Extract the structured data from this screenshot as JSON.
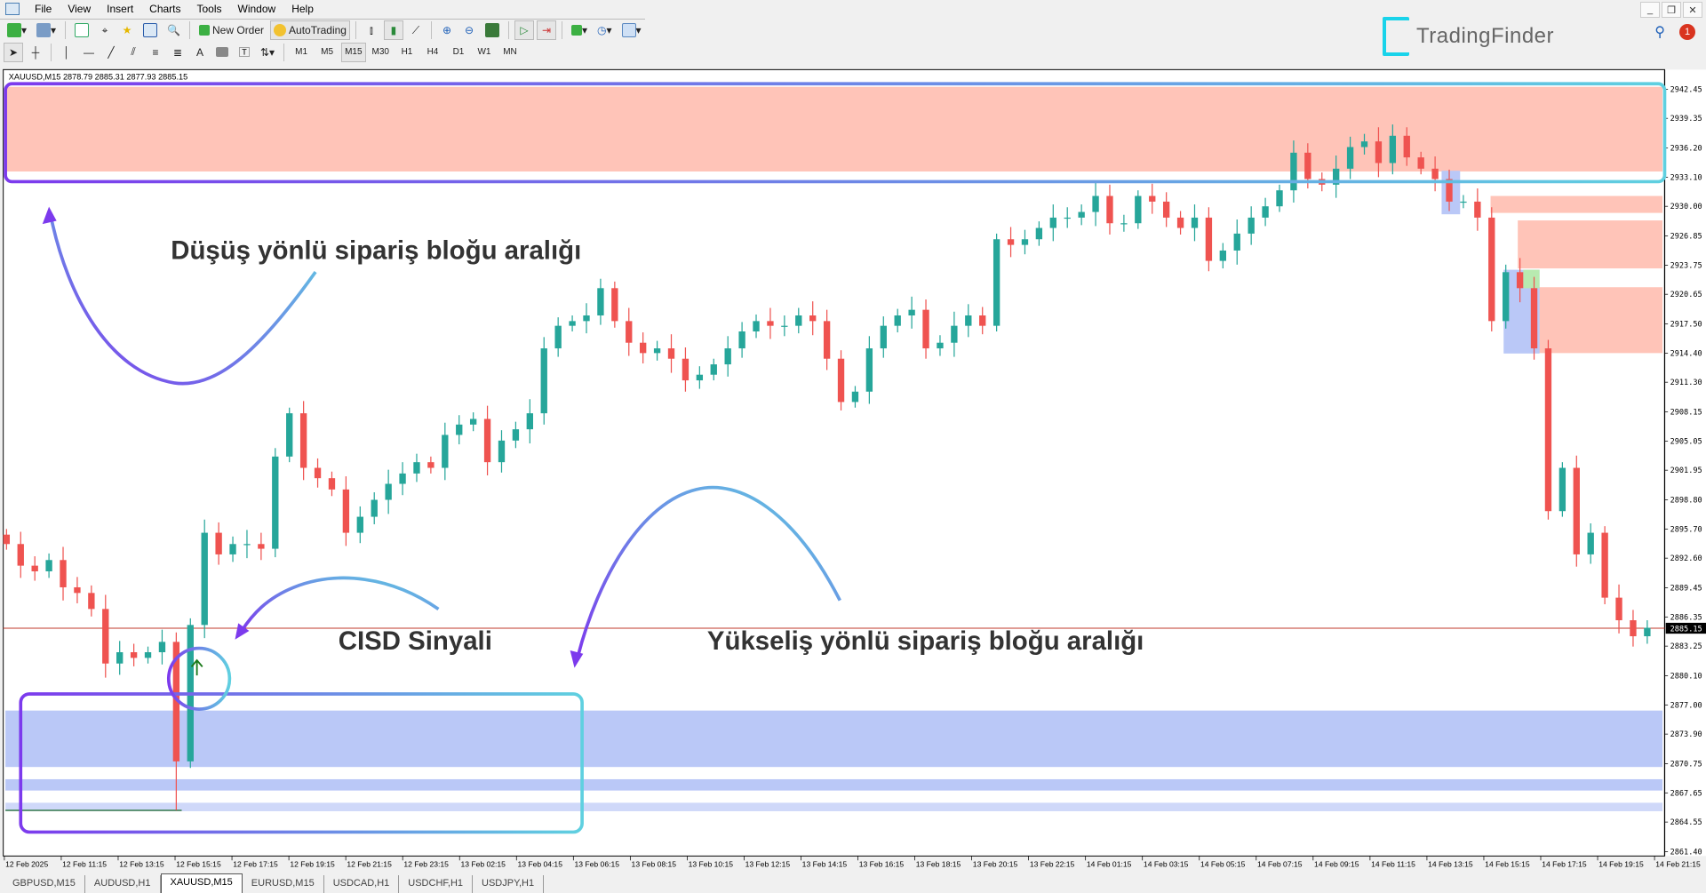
{
  "menu": [
    "File",
    "View",
    "Insert",
    "Charts",
    "Tools",
    "Window",
    "Help"
  ],
  "toolbar": {
    "new_order": "New Order",
    "auto_trading": "AutoTrading",
    "timeframes": [
      "M1",
      "M5",
      "M15",
      "M30",
      "H1",
      "H4",
      "D1",
      "W1",
      "MN"
    ],
    "active_timeframe": "M15"
  },
  "logo": {
    "text": "TradingFinder",
    "color": "#19d3ea"
  },
  "notifications": {
    "count": "1"
  },
  "chart": {
    "header": "XAUUSD,M15  2878.79 2885.31 2877.93 2885.15",
    "current_price": "2885.15",
    "price_labels": [
      "2942.45",
      "2939.35",
      "2936.20",
      "2933.10",
      "2930.00",
      "2926.85",
      "2923.75",
      "2920.65",
      "2917.50",
      "2914.40",
      "2911.30",
      "2908.15",
      "2905.05",
      "2901.95",
      "2898.80",
      "2895.70",
      "2892.60",
      "2889.45",
      "2886.35",
      "2883.25",
      "2880.10",
      "2877.00",
      "2873.90",
      "2870.75",
      "2867.65",
      "2864.55",
      "2861.40"
    ],
    "time_labels": [
      "12 Feb 2025",
      "12 Feb 11:15",
      "12 Feb 13:15",
      "12 Feb 15:15",
      "12 Feb 17:15",
      "12 Feb 19:15",
      "12 Feb 21:15",
      "12 Feb 23:15",
      "13 Feb 02:15",
      "13 Feb 04:15",
      "13 Feb 06:15",
      "13 Feb 08:15",
      "13 Feb 10:15",
      "13 Feb 12:15",
      "13 Feb 14:15",
      "13 Feb 16:15",
      "13 Feb 18:15",
      "13 Feb 20:15",
      "13 Feb 22:15",
      "14 Feb 01:15",
      "14 Feb 03:15",
      "14 Feb 05:15",
      "14 Feb 07:15",
      "14 Feb 09:15",
      "14 Feb 11:15",
      "14 Feb 13:15",
      "14 Feb 15:15",
      "14 Feb 17:15",
      "14 Feb 19:15",
      "14 Feb 21:15"
    ],
    "colors": {
      "bull": "#26a69a",
      "bear": "#ef5350",
      "bearish_zone": "#ffc4b8",
      "bullish_zone": "#bac8f7",
      "price_line": "#c0392b"
    }
  },
  "annotations": {
    "bearish_ob": "Düşüş yönlü sipariş bloğu aralığı",
    "cisd": "CISD Sinyali",
    "bullish_ob": "Yükseliş yönlü sipariş bloğu aralığı"
  },
  "tabs": [
    {
      "label": "GBPUSD,M15"
    },
    {
      "label": "AUDUSD,H1"
    },
    {
      "label": "XAUUSD,M15",
      "active": true
    },
    {
      "label": "EURUSD,M15"
    },
    {
      "label": "USDCAD,H1"
    },
    {
      "label": "USDCHF,H1"
    },
    {
      "label": "USDJPY,H1"
    }
  ],
  "chart_data": {
    "type": "candlestick",
    "symbol": "XAUUSD",
    "timeframe": "M15",
    "ylim": [
      2861.4,
      2942.45
    ],
    "closes": [
      2894.1,
      2891.8,
      2891.2,
      2892.4,
      2889.5,
      2888.9,
      2887.2,
      2881.4,
      2882.6,
      2882.0,
      2882.6,
      2883.7,
      2871.0,
      2885.5,
      2895.3,
      2893.0,
      2894.1,
      2894.1,
      2893.6,
      2903.4,
      2908.0,
      2902.2,
      2901.1,
      2899.9,
      2895.3,
      2897.0,
      2898.8,
      2900.5,
      2901.6,
      2902.8,
      2902.2,
      2905.7,
      2906.8,
      2907.4,
      2902.8,
      2905.1,
      2906.3,
      2908.0,
      2914.9,
      2917.3,
      2917.8,
      2918.4,
      2921.3,
      2917.8,
      2915.5,
      2914.4,
      2914.9,
      2913.8,
      2911.5,
      2912.1,
      2913.2,
      2914.9,
      2916.7,
      2917.8,
      2917.3,
      2917.3,
      2918.4,
      2917.8,
      2913.8,
      2909.2,
      2910.3,
      2914.9,
      2917.3,
      2918.4,
      2919.0,
      2914.9,
      2915.5,
      2917.3,
      2918.4,
      2917.3,
      2926.5,
      2925.9,
      2926.5,
      2927.7,
      2928.8,
      2928.8,
      2929.4,
      2931.1,
      2928.2,
      2928.2,
      2931.1,
      2930.5,
      2928.8,
      2927.7,
      2928.8,
      2924.2,
      2925.3,
      2927.1,
      2928.8,
      2930.0,
      2931.7,
      2935.7,
      2932.9,
      2932.3,
      2934.0,
      2936.3,
      2936.9,
      2934.6,
      2937.5,
      2935.2,
      2934.0,
      2932.9,
      2930.5,
      2930.5,
      2928.8,
      2917.8,
      2923.0,
      2921.3,
      2914.9,
      2897.6,
      2902.2,
      2893.0,
      2895.3,
      2888.4,
      2886.0,
      2884.3,
      2885.2
    ],
    "low_overrides": {
      "12": 2865.8
    },
    "bearish_zones": [
      [
        2942.7,
        2933.7,
        0
      ],
      [
        2931.1,
        2929.3,
        0.88
      ],
      [
        2928.5,
        2923.4,
        0.89
      ],
      [
        2921.4,
        2914.4,
        0.9
      ]
    ],
    "bullish_zones": [
      [
        2876.4,
        2870.4
      ],
      [
        2869.1,
        2867.9
      ],
      [
        2866.6,
        2865.7
      ]
    ],
    "current_price": 2885.15
  }
}
